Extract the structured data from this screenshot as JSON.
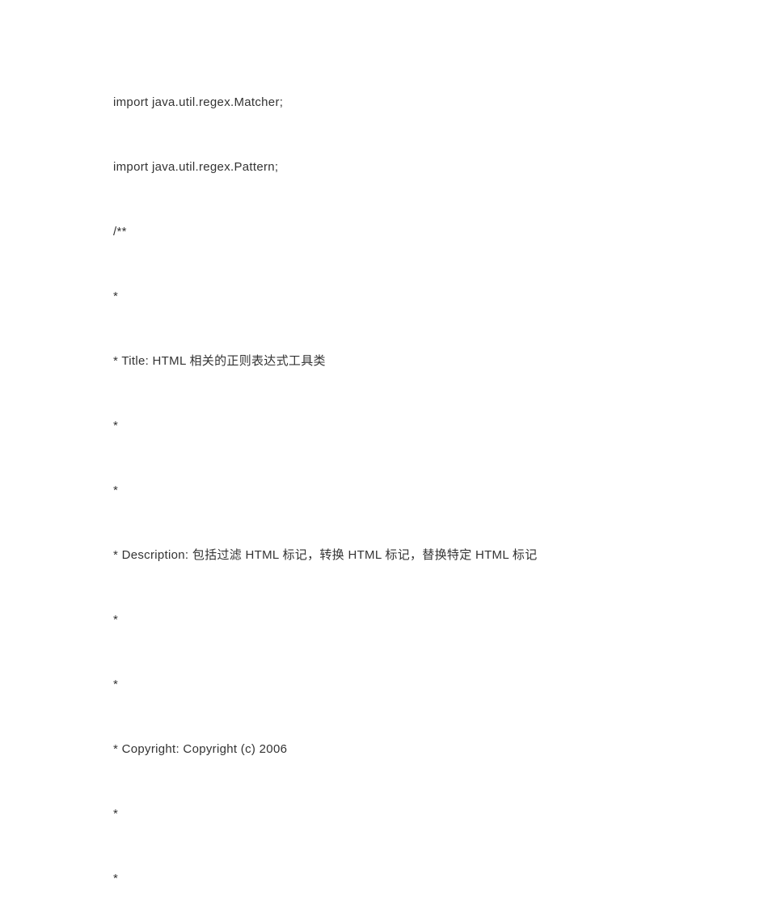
{
  "lines": [
    "import  java.util.regex.Matcher;",
    "import  java.util.regex.Pattern;",
    "/**",
    "*",
    "*  Title:  HTML 相关的正则表达式工具类",
    "*",
    "*",
    "*  Description:  包括过滤 HTML 标记，转换 HTML 标记，替换特定 HTML 标记",
    "*",
    "*",
    "*  Copyright:  Copyright  (c)  2006",
    "*",
    "*"
  ]
}
